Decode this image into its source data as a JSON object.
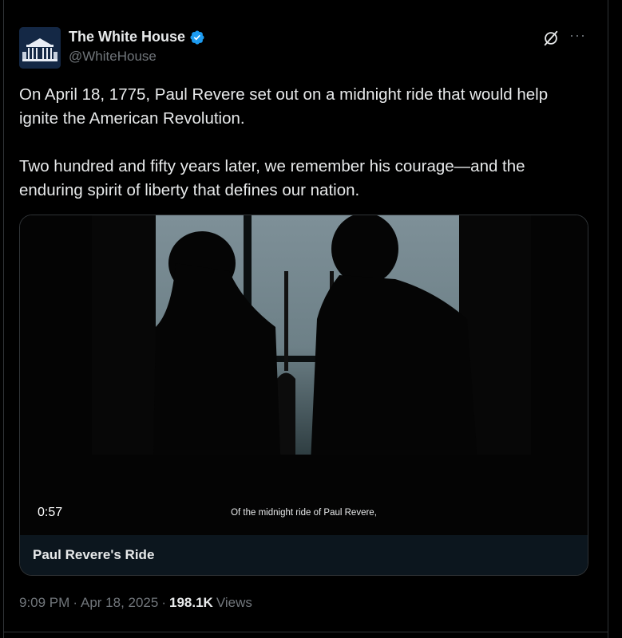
{
  "author": {
    "display_name": "The White House",
    "handle": "@WhiteHouse",
    "verified": true,
    "avatar_icon": "white-house-building-icon"
  },
  "header_actions": {
    "grok_icon": "grok-icon",
    "more_icon": "more-options-icon",
    "more_glyph": "···"
  },
  "tweet": {
    "paragraphs": [
      "On April 18, 1775, Paul Revere set out on a midnight ride that would help ignite the American Revolution.",
      "Two hundred and fifty years later, we remember his courage—and the enduring spirit of liberty that defines our nation."
    ]
  },
  "media": {
    "duration": "0:57",
    "caption": "Of the midnight ride of Paul Revere,",
    "title": "Paul Revere's Ride"
  },
  "meta": {
    "time": "9:09 PM",
    "date": "Apr 18, 2025",
    "separator": "·",
    "views_count": "198.1K",
    "views_label": "Views"
  },
  "colors": {
    "background": "#000000",
    "text_primary": "#e7e9ea",
    "text_secondary": "#71767b",
    "verified_blue": "#1d9bf0",
    "border": "#2f3336",
    "card_title_bg": "#0c161e"
  }
}
